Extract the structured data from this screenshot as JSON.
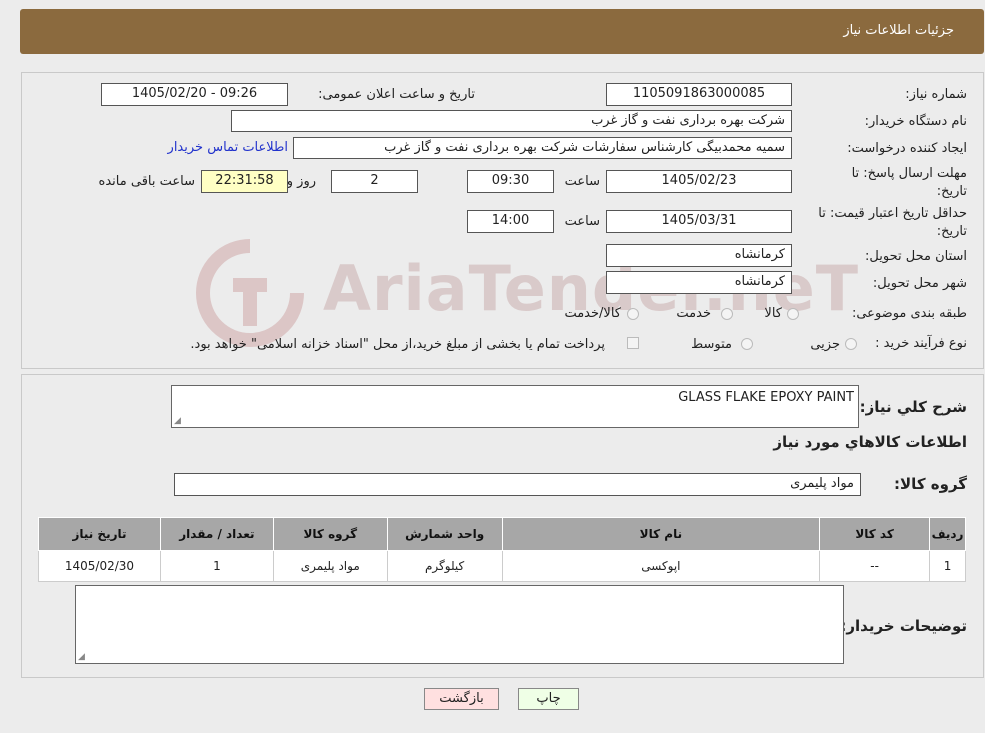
{
  "header": {
    "title": "جزئیات اطلاعات نیاز"
  },
  "watermark": "AriaTender.neT",
  "fields": {
    "need_number_label": "شماره نیاز:",
    "need_number": "1105091863000085",
    "announce_label": "تاریخ و ساعت اعلان عمومی:",
    "announce_value": "1405/02/20 - 09:26",
    "buyer_org_label": "نام دستگاه خریدار:",
    "buyer_org": "شرکت بهره برداری نفت و گاز غرب",
    "creator_label": "ایجاد کننده درخواست:",
    "creator": "سمیه محمدبیگی کارشناس سفارشات شرکت بهره برداری نفت و گاز غرب",
    "contact_link": "اطلاعات تماس خریدار",
    "deadline_label": "مهلت ارسال پاسخ: تا تاریخ:",
    "deadline_date": "1405/02/23",
    "time_label": "ساعت",
    "deadline_time": "09:30",
    "days_value": "2",
    "days_label": "روز و",
    "remaining_time": "22:31:58",
    "remaining_label": "ساعت باقی مانده",
    "validity_label": "حداقل تاریخ اعتبار قیمت: تا تاریخ:",
    "validity_date": "1405/03/31",
    "validity_time": "14:00",
    "province_label": "استان محل تحویل:",
    "province": "کرمانشاه",
    "city_label": "شهر محل تحویل:",
    "city": "کرمانشاه",
    "category_label": "طبقه بندی موضوعی:",
    "category_options": [
      "کالا",
      "خدمت",
      "کالا/خدمت"
    ],
    "process_label": "نوع فرآیند خرید :",
    "process_options": [
      "جزیی",
      "متوسط"
    ],
    "payment_note": "پرداخت تمام یا بخشی از مبلغ خرید،از محل \"اسناد خزانه اسلامی\" خواهد بود."
  },
  "details": {
    "summary_label": "شرح کلي نياز:",
    "summary_value": "GLASS FLAKE EPOXY PAINT",
    "goods_info_title": "اطلاعات کالاهاي مورد نياز",
    "goods_group_label": "گروه کالا:",
    "goods_group_value": "مواد پلیمری",
    "table": {
      "headers": [
        "رديف",
        "کد کالا",
        "نام کالا",
        "واحد شمارش",
        "گروه کالا",
        "تعداد / مقدار",
        "تاريخ نياز"
      ],
      "rows": [
        [
          "1",
          "--",
          "اپوکسی",
          "کیلوگرم",
          "مواد پلیمری",
          "1",
          "1405/02/30"
        ]
      ]
    },
    "buyer_notes_label": "توضیحات خریدار:"
  },
  "buttons": {
    "print": "چاپ",
    "back": "بازگشت"
  }
}
